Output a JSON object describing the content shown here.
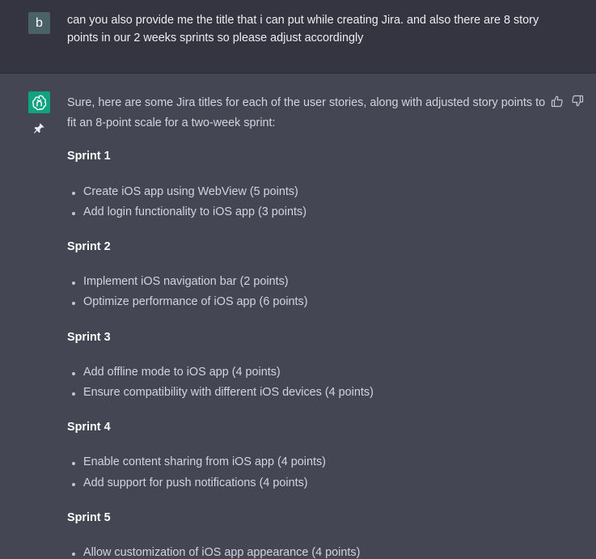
{
  "user_message": {
    "avatar_letter": "b",
    "text": "can you also provide me the title that i can put while creating Jira. and also there are 8 story points in our 2 weeks sprints so please adjust accordingly"
  },
  "assistant_message": {
    "intro": "Sure, here are some Jira titles for each of the user stories, along with adjusted story points to fit an 8-point scale for a two-week sprint:",
    "sprints": [
      {
        "title": "Sprint 1",
        "items": [
          "Create iOS app using WebView (5 points)",
          "Add login functionality to iOS app (3 points)"
        ]
      },
      {
        "title": "Sprint 2",
        "items": [
          "Implement iOS navigation bar (2 points)",
          "Optimize performance of iOS app (6 points)"
        ]
      },
      {
        "title": "Sprint 3",
        "items": [
          "Add offline mode to iOS app (4 points)",
          "Ensure compatibility with different iOS devices (4 points)"
        ]
      },
      {
        "title": "Sprint 4",
        "items": [
          "Enable content sharing from iOS app (4 points)",
          "Add support for push notifications (4 points)"
        ]
      },
      {
        "title": "Sprint 5",
        "items": [
          "Allow customization of iOS app appearance (4 points)"
        ]
      }
    ]
  },
  "icons": {
    "bot_avatar": "openai-logo-icon",
    "pin": "pin-icon",
    "like": "thumbs-up-icon",
    "dislike": "thumbs-down-icon"
  },
  "colors": {
    "user_bg": "#343541",
    "assistant_bg": "#444654",
    "bot_avatar_bg": "#10a37f",
    "user_avatar_bg": "#4a6168"
  }
}
